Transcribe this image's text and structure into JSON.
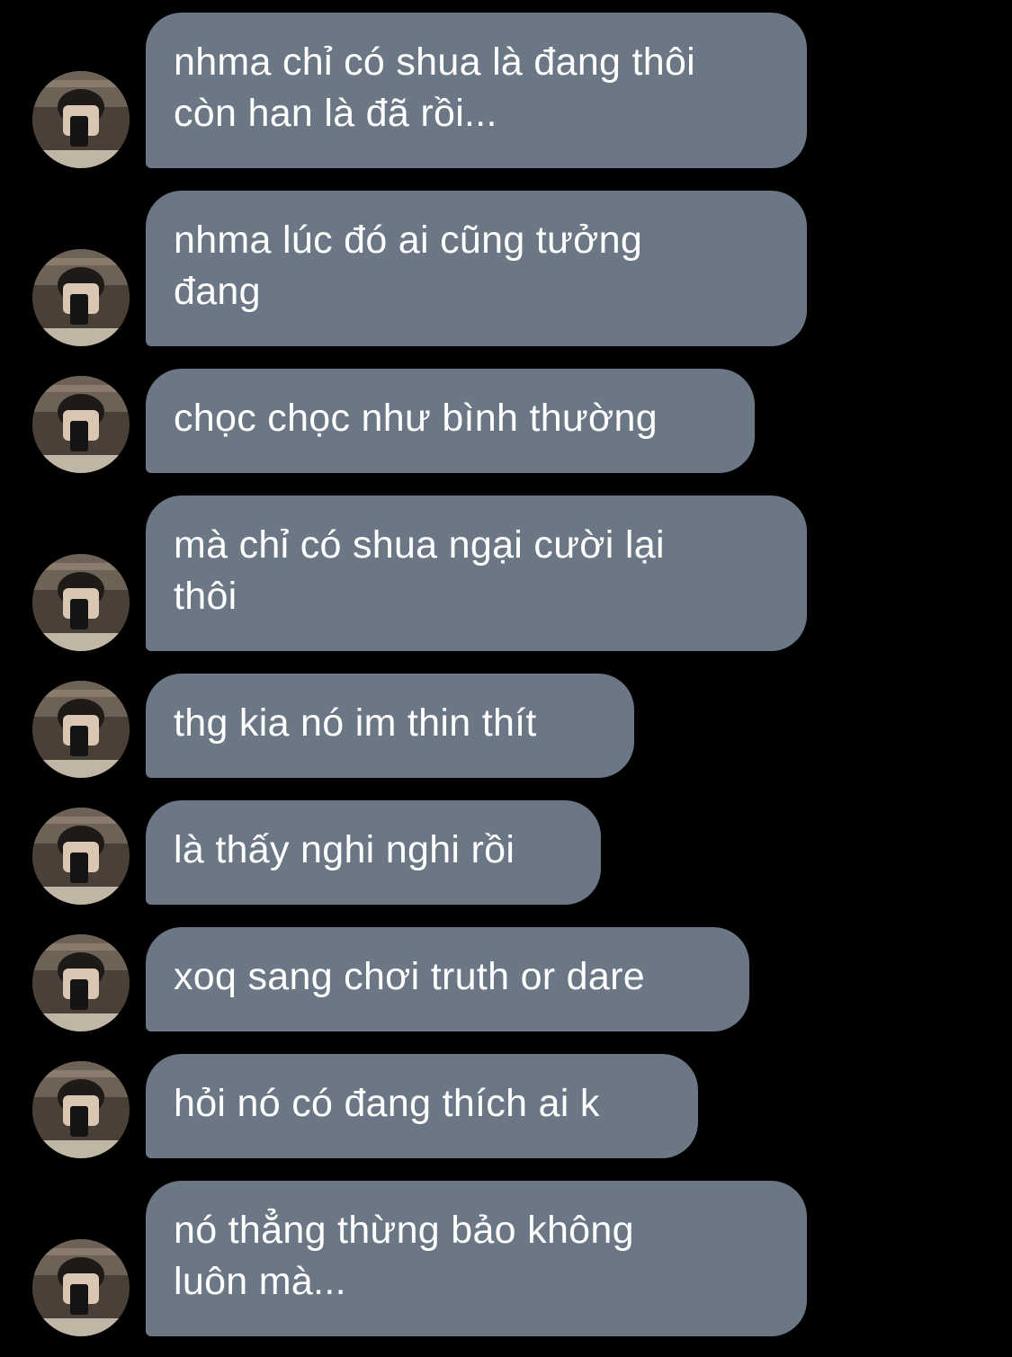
{
  "chat": {
    "bubble_color": "#6b7785",
    "text_color": "#ffffff",
    "background": "#000000",
    "avatar_icon": "profile-photo",
    "messages": [
      {
        "text": "nhma chỉ có shua là đang thôi\ncòn han là đã rồi..."
      },
      {
        "text": "nhma lúc đó ai cũng tưởng\nđang"
      },
      {
        "text": "chọc chọc như bình thường"
      },
      {
        "text": "mà chỉ có shua ngại cười lại\nthôi"
      },
      {
        "text": "thg kia nó im thin thít"
      },
      {
        "text": "là thấy nghi nghi rồi"
      },
      {
        "text": "xoq sang chơi truth or dare"
      },
      {
        "text": "hỏi nó có đang thích ai k"
      },
      {
        "text": "nó thẳng thừng bảo không\nluôn mà..."
      }
    ]
  }
}
